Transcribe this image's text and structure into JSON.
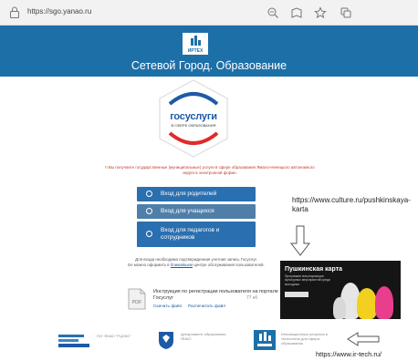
{
  "browser": {
    "url": "https://sgo.yanao.ru",
    "icons": [
      "lock-icon",
      "zoom-icon",
      "reader-icon",
      "favorites-icon",
      "collections-icon"
    ]
  },
  "header": {
    "logo_text": "ИРТЕХ",
    "title": "Сетевой Город. Образование",
    "background": "#1d6fa8"
  },
  "badge": {
    "main": "госуслуги",
    "sub": "В СФЕРЕ ОБРАЗОВАНИЯ"
  },
  "notice": {
    "text": "!! Вы получаете государственные (муниципальные) услуги в сфере образования Ямало-Ненецкого автономного округа в электронной форме."
  },
  "login": {
    "parents": "Вход для родителей",
    "students": "Вход для учащихся",
    "staff": "Вход для педагогов и сотрудников"
  },
  "account_note": {
    "line1": "Для входа необходима подтвержденная учетная запись Госуслуг.",
    "line2_before": "Ее можно оформить в",
    "line2_link": "ближайшем",
    "line2_after": "центре обслуживания пользователей."
  },
  "instruction": {
    "icon_label": "PDF",
    "title": "Инструкция по регистрации пользователя на портале Госуслуг",
    "size": "77 кб",
    "open": "Скачать файл",
    "print": "Распечатать файл"
  },
  "annotation": {
    "culture_url": "https://www.culture.ru/pushkinskaya-karta",
    "irtech_url": "https://www.ir-tech.ru/"
  },
  "promo": {
    "title": "Пушкинская карта",
    "subtitle": "Программа популяризации культурных мероприятий среди молодежи"
  },
  "partners": [
    {
      "name": "ГКУ ЯНАО \"РЦОКО\"",
      "icon": "rcoko-logo"
    },
    {
      "name": "Департамент образования ЯНАО",
      "icon": "yanao-crest-icon"
    },
    {
      "name": "Инновационные решения и технологии для сферы образования",
      "icon": "irtech-logo"
    }
  ]
}
